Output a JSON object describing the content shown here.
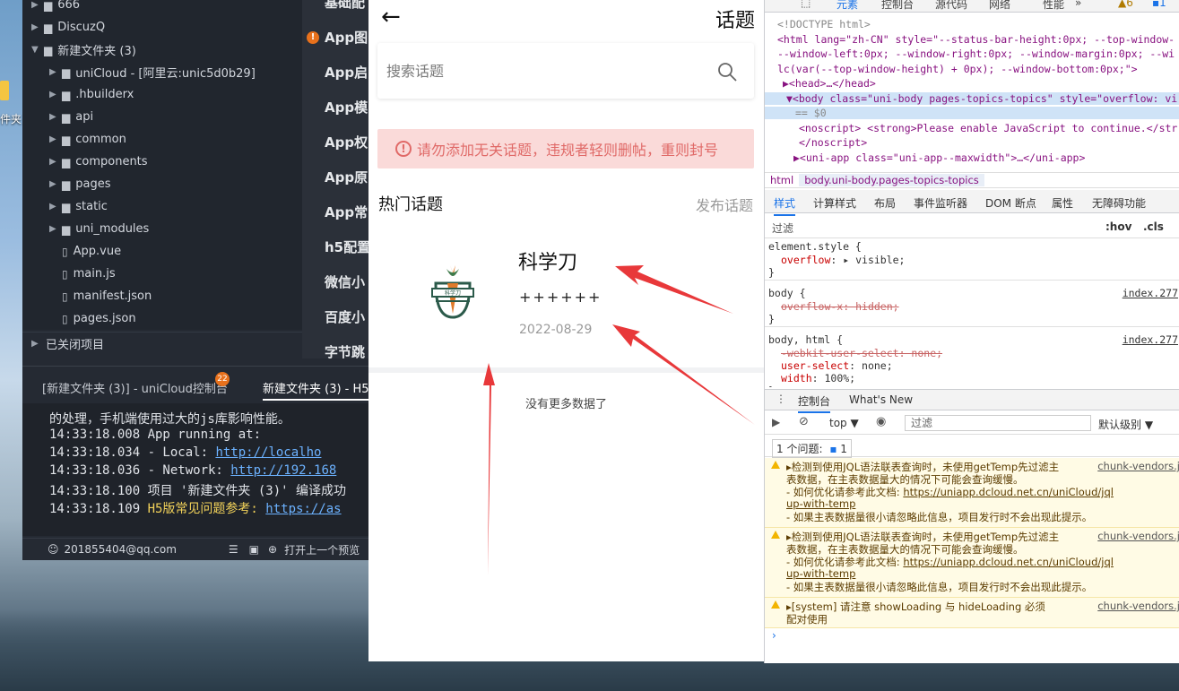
{
  "desktop": {
    "icon_label": "件夹"
  },
  "ide": {
    "tree": [
      {
        "label": "666",
        "icon": "folder-icon",
        "indent": 0
      },
      {
        "label": "DiscuzQ",
        "icon": "folder-icon",
        "indent": 0
      },
      {
        "label": "新建文件夹 (3)",
        "icon": "folder-icon",
        "indent": 0
      },
      {
        "label": "uniCloud - [阿里云:unic5d0b29]",
        "icon": "folder-icon",
        "indent": 1
      },
      {
        "label": ".hbuilderx",
        "icon": "folder-icon",
        "indent": 1
      },
      {
        "label": "api",
        "icon": "folder-icon",
        "indent": 1
      },
      {
        "label": "common",
        "icon": "folder-icon",
        "indent": 1
      },
      {
        "label": "components",
        "icon": "folder-icon",
        "indent": 1
      },
      {
        "label": "pages",
        "icon": "folder-icon",
        "indent": 1
      },
      {
        "label": "static",
        "icon": "folder-icon",
        "indent": 1
      },
      {
        "label": "uni_modules",
        "icon": "folder-icon",
        "indent": 1
      },
      {
        "label": "App.vue",
        "icon": "file-icon",
        "indent": 1
      },
      {
        "label": "main.js",
        "icon": "file-icon",
        "indent": 1
      },
      {
        "label": "manifest.json",
        "icon": "file-icon",
        "indent": 1
      },
      {
        "label": "pages.json",
        "icon": "file-icon",
        "indent": 1
      }
    ],
    "closed_projects": "已关闭项目",
    "doc_items": [
      "基础配",
      "App图",
      "App启",
      "App模",
      "App权",
      "App原",
      "App常",
      "h5配置",
      "微信小",
      "百度小",
      "字节跳"
    ],
    "console_tabs": [
      "[新建文件夹 (3)] - uniCloud控制台",
      "新建文件夹 (3) - H5"
    ],
    "console_badge": "22",
    "console_lines": [
      {
        "t": "的处理，手机端使用过大的js库影响性能。",
        "link": ""
      },
      {
        "t": "14:33:18.008   App running at:",
        "link": ""
      },
      {
        "t": "14:33:18.034   - Local:   ",
        "link": "http://localho"
      },
      {
        "t": "14:33:18.036   - Network: ",
        "link": "http://192.168"
      },
      {
        "t": "14:33:18.100 项目 '新建文件夹 (3)' 编译成功",
        "link": ""
      },
      {
        "t": "14:33:18.109 ",
        "yellow": "H5版常见问题参考: ",
        "link": "https://as"
      }
    ],
    "status_user": "201855404@qq.com",
    "status_open": "打开上一个预览"
  },
  "phone": {
    "title": "话题",
    "search_placeholder": "搜索话题",
    "alert": "请勿添加无关话题，违规者轻则删帖，重则封号",
    "hot_title": "热门话题",
    "publish": "发布话题",
    "topic": {
      "name": "科学刀",
      "desc": "++++++",
      "date": "2022-08-29",
      "logo_text": "科学刀"
    },
    "no_more": "没有更多数据了"
  },
  "devtools": {
    "top_tabs": [
      "元素",
      "控制台",
      "源代码",
      "网络",
      "性能",
      "»"
    ],
    "warn_count": "6",
    "info_count": "1",
    "elements": [
      "<!DOCTYPE html>",
      "<html lang=\"zh-CN\" style=\"--status-bar-height:0px; --top-window-",
      "--window-left:0px; --window-right:0px; --window-margin:0px; --wi",
      "lc(var(--top-window-height) + 0px); --window-bottom:0px;\">",
      "▶<head>…</head>",
      "▼<body class=\"uni-body pages-topics-topics\" style=\"overflow: vi",
      "== $0",
      "<noscript> <strong>Please enable JavaScript to continue.</str",
      "</noscript>",
      "▶<uni-app class=\"uni-app--maxwidth\">…</uni-app>"
    ],
    "breadcrumb": [
      "html",
      "body.uni-body.pages-topics-topics"
    ],
    "style_tabs": [
      "样式",
      "计算样式",
      "布局",
      "事件监听器",
      "DOM 断点",
      "属性",
      "无障碍功能"
    ],
    "filter": "过滤",
    "hov": ":hov",
    "cls": ".cls",
    "rules": [
      {
        "sel": "element.style {",
        "props": [
          {
            "p": "overflow",
            "v": "▸ visible;",
            "strike": false
          }
        ],
        "src": ""
      },
      {
        "sel": "body {",
        "props": [
          {
            "p": "overflow-x",
            "v": "hidden;",
            "strike": true
          }
        ],
        "src": "index.277"
      },
      {
        "sel": "body, html {",
        "props": [
          {
            "p": "-webkit-user-select",
            "v": "none;",
            "strike": true
          },
          {
            "p": "user-select",
            "v": "none;",
            "strike": false
          },
          {
            "p": "width",
            "v": "100%;",
            "strike": false
          }
        ],
        "src": "index.277"
      }
    ],
    "drawer_tabs": [
      "控制台",
      "What's New"
    ],
    "context": "top ▼",
    "console_filter": "过滤",
    "level": "默认级别 ▼",
    "issues_label": "1 个问题:",
    "issues_count": "1",
    "warnings": [
      {
        "l1": "▸检测到使用JQL语法联表查询时，未使用getTemp先过滤主",
        "l2": "表数据，在主表数据量大的情况下可能会查询缓慢。",
        "l3": "- 如何优化请参考此文档: ",
        "link": "https://uniapp.dcloud.net.cn/uniCloud/jql",
        "l4": "up-with-temp",
        "l5": "- 如果主表数据量很小请忽略此信息，项目发行时不会出现此提示。",
        "src": "chunk-vendors.j"
      },
      {
        "l1": "▸检测到使用JQL语法联表查询时，未使用getTemp先过滤主",
        "l2": "表数据，在主表数据量大的情况下可能会查询缓慢。",
        "l3": "- 如何优化请参考此文档: ",
        "link": "https://uniapp.dcloud.net.cn/uniCloud/jql",
        "l4": "up-with-temp",
        "l5": "- 如果主表数据量很小请忽略此信息，项目发行时不会出现此提示。",
        "src": "chunk-vendors.j"
      },
      {
        "l1": "▸[system] 请注意 showLoading 与 hideLoading 必须",
        "l2": "配对使用",
        "src": "chunk-vendors.j"
      }
    ],
    "prompt": "›"
  }
}
